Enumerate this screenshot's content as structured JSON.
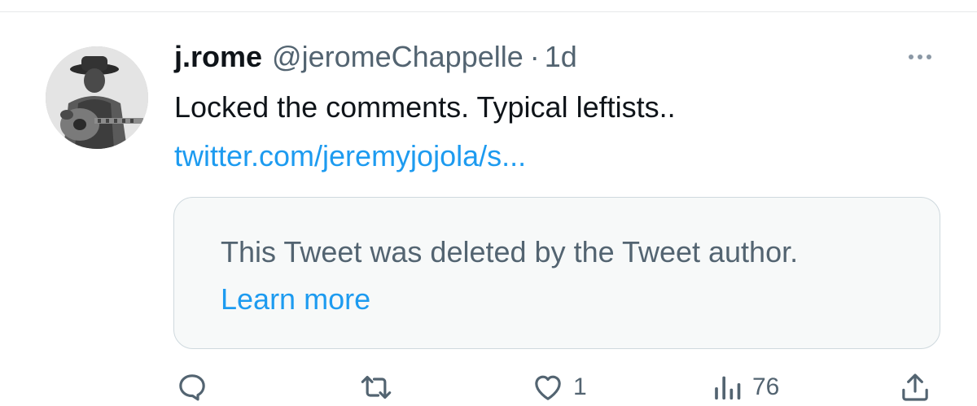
{
  "tweet": {
    "display_name": "j.rome",
    "handle": "@jeromeChappelle",
    "separator": "·",
    "timestamp": "1d",
    "text": "Locked the comments. Typical leftists..",
    "link": "twitter.com/jeremyjojola/s..."
  },
  "quoted": {
    "message": "This Tweet was deleted by the Tweet author.",
    "learn_more": "Learn more"
  },
  "actions": {
    "reply_icon": "reply-icon",
    "retweet_icon": "retweet-icon",
    "like_icon": "heart-icon",
    "like_count": "1",
    "views_icon": "bar-chart-icon",
    "views_count": "76",
    "share_icon": "share-icon"
  },
  "colors": {
    "text": "#0f1419",
    "secondary": "#536471",
    "link": "#1d9bf0",
    "quote_bg": "#f7f9f9",
    "border": "#cfd9de"
  }
}
